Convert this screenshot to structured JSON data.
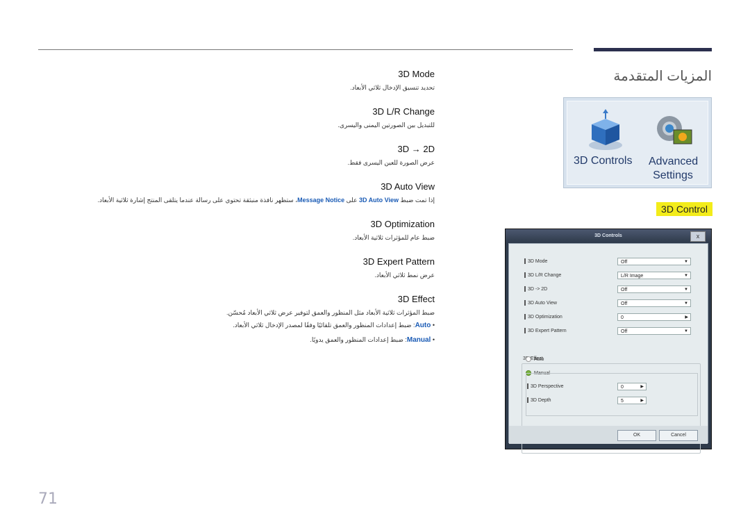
{
  "section_title": "المزيات المتقدمة",
  "badge": "3D Control",
  "page_number": "71",
  "items": [
    {
      "heading": "3D Mode",
      "desc": "تحديد تنسيق الإدخال ثلاثي الأبعاد."
    },
    {
      "heading": "3D L/R Change",
      "desc": "للتبديل بين الصورتين اليمنى واليسرى."
    },
    {
      "heading": "3D → 2D",
      "desc": "عرض الصورة للعين اليسرى فقط."
    },
    {
      "heading": "3D Auto View",
      "desc_pre": "إذا تمت ضبط ",
      "desc_kw1": "3D Auto View",
      "desc_mid": " على ",
      "desc_kw2": "Message Notice",
      "desc_post": "، ستظهر نافذة منبثقة تحتوي على رسالة عندما يتلقى المنتج إشارة ثلاثية الأبعاد."
    },
    {
      "heading": "3D Optimization",
      "desc": "ضبط عام للمؤثرات ثلاثية الأبعاد."
    },
    {
      "heading": "3D Expert Pattern",
      "desc": "عرض نمط ثلاثي الأبعاد."
    },
    {
      "heading": "3D Effect",
      "desc": "ضبط المؤثرات ثلاثية الأبعاد مثل المنظور والعمق لتوفير عرض ثلاثي الأبعاد مُحسّن."
    }
  ],
  "bullets": [
    {
      "kw": "Auto",
      "text": ": ضبط إعدادات المنظور والعمق تلقائيًا وفقًا لمصدر الإدخال ثلاثي الأبعاد."
    },
    {
      "kw": "Manual",
      "text": ": ضبط إعدادات المنظور والعمق يدويًا."
    }
  ],
  "tile": {
    "label1": "3D Controls",
    "label2_line1": "Advanced",
    "label2_line2": "Settings"
  },
  "dialog": {
    "title": "3D Controls",
    "close": "x",
    "rows": [
      {
        "label": "3D Mode",
        "value": "Off"
      },
      {
        "label": "3D L/R Change",
        "value": "L/R Image"
      },
      {
        "label": "3D -> 2D",
        "value": "Off"
      },
      {
        "label": "3D Auto View",
        "value": "Off"
      },
      {
        "label": "3D Optimization",
        "value": "0"
      },
      {
        "label": "3D Expert Pattern",
        "value": "Off"
      }
    ],
    "effect_label": "3D Effect",
    "radio_auto": "Auto",
    "radio_manual": "Manual",
    "perspective_label": "3D Perspective",
    "perspective_value": "0",
    "depth_label": "3D Depth",
    "depth_value": "5",
    "ok": "OK",
    "cancel": "Cancel"
  }
}
